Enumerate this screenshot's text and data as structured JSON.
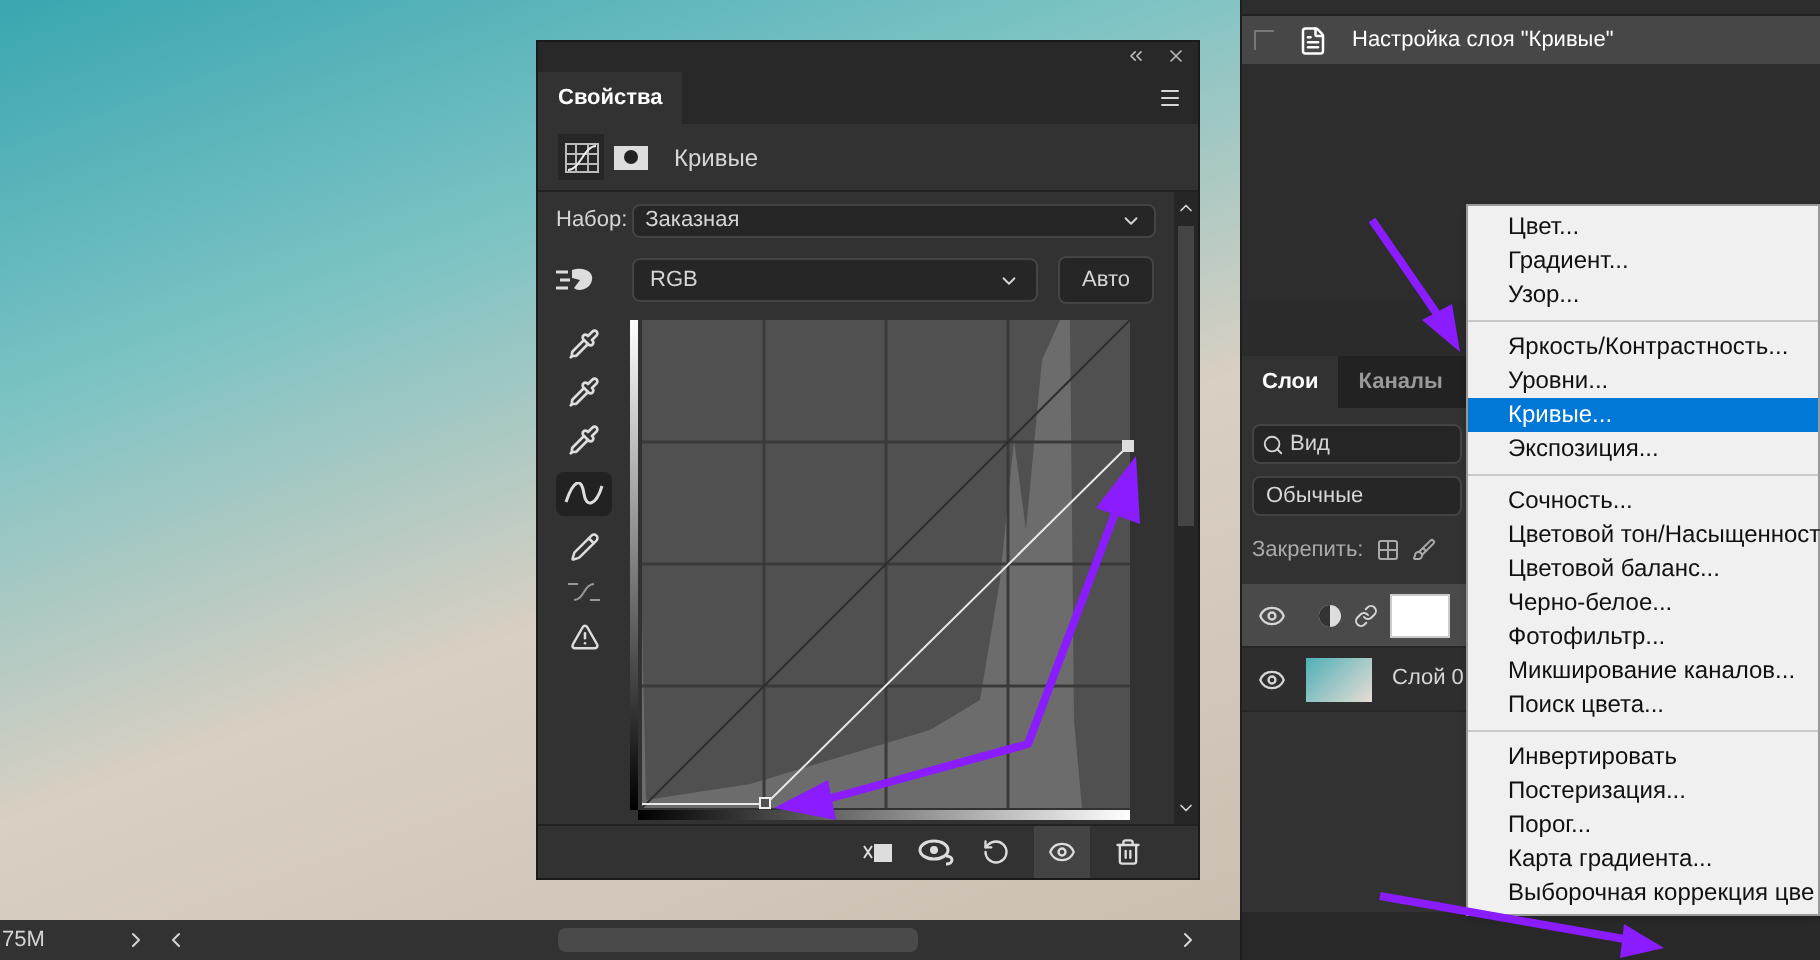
{
  "history": {
    "items": [
      {
        "label": "Настройка слоя \"Кривые\"",
        "selected": true
      }
    ]
  },
  "properties": {
    "tab": "Свойства",
    "adjustment": "Кривые",
    "preset_label": "Набор:",
    "preset": "Заказная",
    "channel": "RGB",
    "auto_button": "Авто"
  },
  "layers_panel": {
    "tabs": [
      {
        "label": "Слои",
        "selected": true
      },
      {
        "label": "Каналы",
        "selected": false
      }
    ],
    "search": "Вид",
    "blend_mode": "Обычные",
    "lock_label": "Закрепить:",
    "layers": [
      {
        "kind": "adjustment",
        "visible": true,
        "selected": true
      },
      {
        "kind": "pixel",
        "label": "Слой 0",
        "visible": true,
        "selected": false
      }
    ]
  },
  "menu": {
    "sections": [
      {
        "items": [
          {
            "label": "Цвет...",
            "selected": false
          },
          {
            "label": "Градиент...",
            "selected": false
          },
          {
            "label": "Узор...",
            "selected": false
          }
        ]
      },
      {
        "items": [
          {
            "label": "Яркость/Контрастность...",
            "selected": false
          },
          {
            "label": "Уровни...",
            "selected": false
          },
          {
            "label": "Кривые...",
            "selected": true
          },
          {
            "label": "Экспозиция...",
            "selected": false
          }
        ]
      },
      {
        "items": [
          {
            "label": "Сочность...",
            "selected": false
          },
          {
            "label": "Цветовой тон/Насыщенност",
            "selected": false
          },
          {
            "label": "Цветовой баланс...",
            "selected": false
          },
          {
            "label": "Черно-белое...",
            "selected": false
          },
          {
            "label": "Фотофильтр...",
            "selected": false
          },
          {
            "label": "Микширование каналов...",
            "selected": false
          },
          {
            "label": "Поиск цвета...",
            "selected": false
          }
        ]
      },
      {
        "items": [
          {
            "label": "Инвертировать",
            "selected": false
          },
          {
            "label": "Постеризация...",
            "selected": false
          },
          {
            "label": "Порог...",
            "selected": false
          },
          {
            "label": "Карта градиента...",
            "selected": false
          },
          {
            "label": "Выборочная коррекция цве",
            "selected": false
          }
        ]
      }
    ]
  },
  "status_bar": {
    "doc_size": "75M"
  }
}
